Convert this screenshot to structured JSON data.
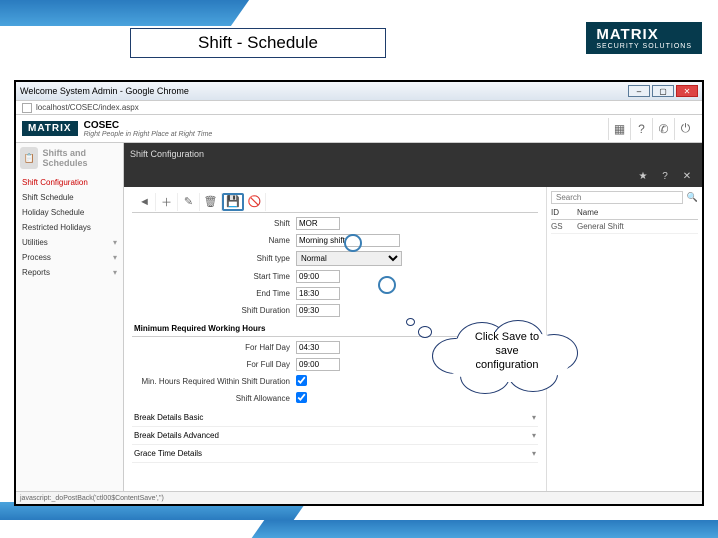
{
  "slide": {
    "title": "Shift - Schedule"
  },
  "logo": {
    "brand": "MATRIX",
    "sub": "SECURITY SOLUTIONS"
  },
  "window": {
    "title": "Welcome System Admin - Google Chrome",
    "url": "localhost/COSEC/index.aspx"
  },
  "app": {
    "name": "COSEC",
    "tagline": "Right People in Right Place at Right Time",
    "logo": "MATRIX"
  },
  "sidebar": {
    "title": "Shifts and Schedules",
    "items": [
      {
        "label": "Shift Configuration",
        "active": true
      },
      {
        "label": "Shift Schedule"
      },
      {
        "label": "Holiday Schedule"
      },
      {
        "label": "Restricted Holidays"
      },
      {
        "label": "Utilities",
        "expandable": true
      },
      {
        "label": "Process",
        "expandable": true
      },
      {
        "label": "Reports",
        "expandable": true
      }
    ]
  },
  "toolbar": {
    "title": "Shift Configuration"
  },
  "subtoolbar": {
    "search_placeholder": "Search"
  },
  "form": {
    "shift_label": "Shift",
    "shift_value": "MOR",
    "name_label": "Name",
    "name_value": "Morning shift",
    "type_label": "Shift type",
    "type_value": "Normal",
    "start_label": "Start Time",
    "start_value": "09:00",
    "end_label": "End Time",
    "end_value": "18:30",
    "dur_label": "Shift Duration",
    "dur_value": "09:30",
    "minreq_section": "Minimum Required Working Hours",
    "half_label": "For Half Day",
    "half_value": "04:30",
    "full_label": "For Full Day",
    "full_value": "09:00",
    "within_label": "Min. Hours Required Within Shift Duration",
    "allow_label": "Shift Allowance",
    "break_basic": "Break Details Basic",
    "break_adv": "Break Details Advanced",
    "grace": "Grace Time Details"
  },
  "list": {
    "h1": "ID",
    "h2": "Name",
    "rows": [
      {
        "id": "GS",
        "name": "General Shift"
      }
    ]
  },
  "status": {
    "text": "javascript:_doPostBack('ctl00$ContentSave','')"
  },
  "callout": {
    "line1": "Click Save to",
    "line2": "save",
    "line3": "configuration"
  }
}
